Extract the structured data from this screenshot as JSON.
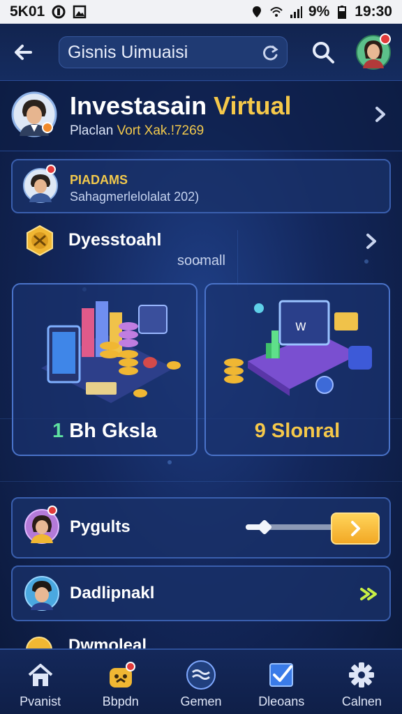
{
  "status_bar": {
    "left_text": "5K01",
    "battery_text": "9%",
    "time": "19:30"
  },
  "app_bar": {
    "search_value": "Gisnis Uimuaisi",
    "back_icon": "arrow-left-icon",
    "refresh_icon": "refresh-icon",
    "search_icon": "search-icon"
  },
  "profile": {
    "title_main": "Investasain ",
    "title_accent": "Virtual",
    "subtitle_prefix": "Placlan ",
    "subtitle_value": "Vort Xak.!7269"
  },
  "programs_card": {
    "label": "PIADAMS",
    "subtitle": "Sahagmerlelolalat 202)"
  },
  "discovery": {
    "label": "Dyesstoahl",
    "sub": "soo̵mall"
  },
  "tiles": [
    {
      "num": "1",
      "text": " Bh Gksla"
    },
    {
      "text": "9 Slonral"
    }
  ],
  "rows": [
    {
      "label": "Pygults",
      "slider_fraction": 0.2
    },
    {
      "label": "Dadlipnakl"
    }
  ],
  "partial_row": {
    "label": "Dwmoleal"
  },
  "bottom_nav": [
    {
      "label": "Pvanist",
      "icon": "home-icon"
    },
    {
      "label": "Bbpdn",
      "icon": "bag-icon"
    },
    {
      "label": "Gemen",
      "icon": "waves-icon"
    },
    {
      "label": "Dleoans",
      "icon": "checkbox-icon"
    },
    {
      "label": "Calnen",
      "icon": "gear-icon"
    }
  ],
  "colors": {
    "accent_yellow": "#f5c84a",
    "accent_green": "#5ee0a0",
    "card_border": "#3a5fae",
    "background": "#13275c"
  }
}
